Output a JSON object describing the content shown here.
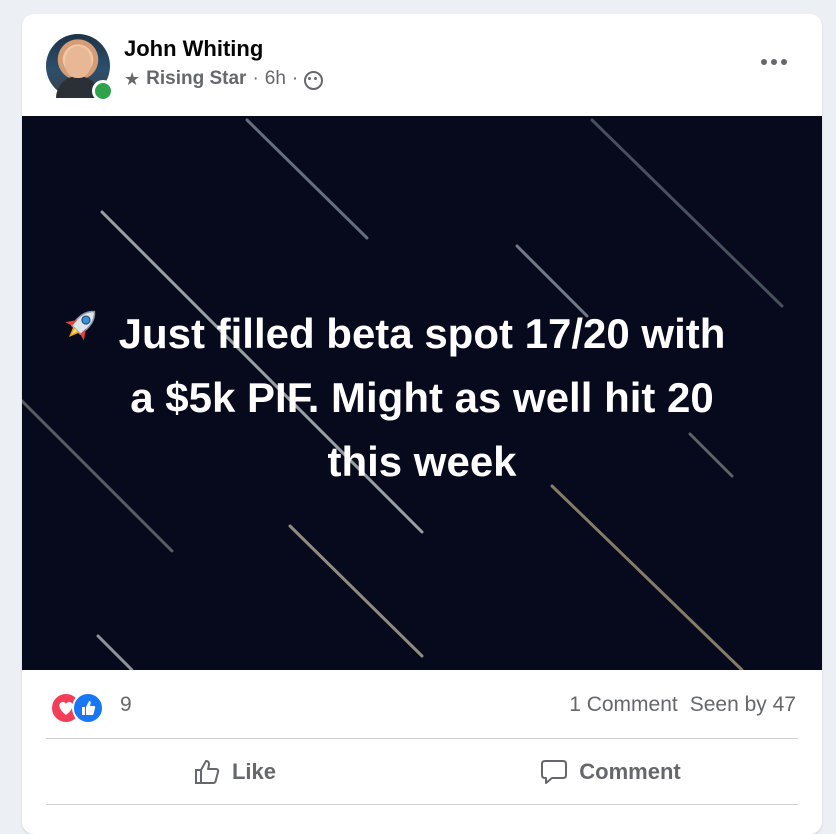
{
  "post": {
    "author": "John Whiting",
    "badge": "Rising Star",
    "sep1": "·",
    "time": "6h",
    "sep2": "·",
    "text_line1": "Just filled beta spot 17/20 with",
    "text_line2": "a $5k PIF. Might as well hit 20",
    "text_line3": "this week",
    "image_bg": "#07091c"
  },
  "stats": {
    "reaction_count": "9",
    "comments": "1 Comment",
    "seen": "Seen by 47"
  },
  "actions": {
    "like_label": "Like",
    "comment_label": "Comment"
  },
  "icons": {
    "more": "more-options-icon",
    "audience": "globe-icon",
    "badge": "star-icon",
    "love": "love-reaction-icon",
    "like": "like-reaction-icon",
    "rocket": "rocket-emoji"
  },
  "colors": {
    "love": "#f33e58",
    "like": "#1877f2",
    "online": "#31a24c",
    "muted_text": "#65676b"
  }
}
